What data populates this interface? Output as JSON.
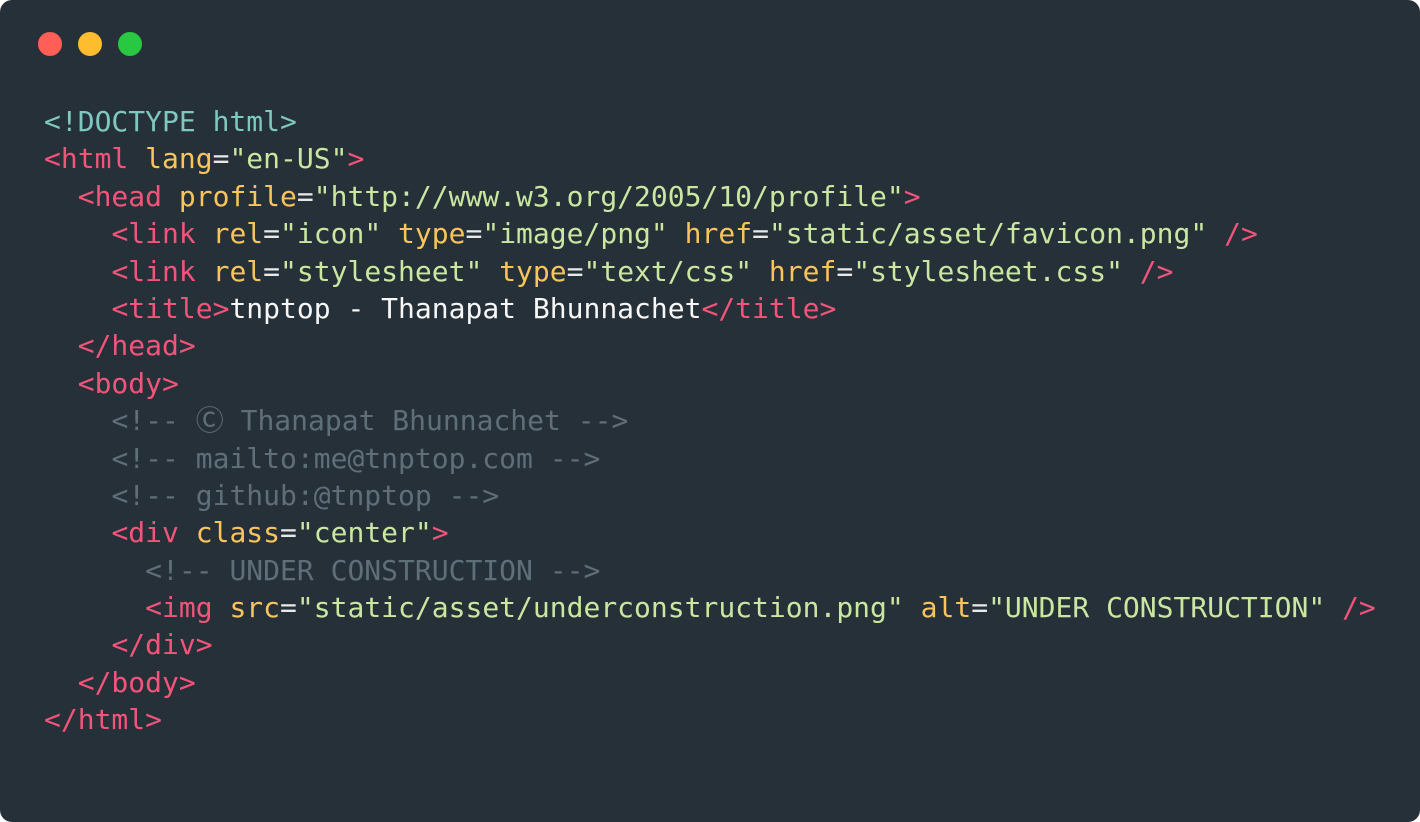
{
  "window": {
    "buttons": [
      {
        "name": "close",
        "color": "#ff5f57"
      },
      {
        "name": "minimize",
        "color": "#febc2e"
      },
      {
        "name": "zoom",
        "color": "#28c840"
      }
    ]
  },
  "theme": {
    "background": "#263038",
    "doctype": "#7ec8c0",
    "tag": "#f2547a",
    "attr": "#f8c45c",
    "string": "#c9e7a0",
    "text": "#f7f7f7",
    "comment": "#5f6f7a",
    "punct": "#e8e8e8"
  },
  "code_lines": [
    {
      "indent": 0,
      "tokens": [
        {
          "t": "doctype",
          "v": "<!DOCTYPE html>"
        }
      ]
    },
    {
      "indent": 0,
      "tokens": [
        {
          "t": "tag",
          "v": "<html"
        },
        {
          "t": "text",
          "v": " "
        },
        {
          "t": "attr",
          "v": "lang"
        },
        {
          "t": "punct",
          "v": "="
        },
        {
          "t": "string",
          "v": "\"en-US\""
        },
        {
          "t": "tag",
          "v": ">"
        }
      ]
    },
    {
      "indent": 1,
      "tokens": [
        {
          "t": "tag",
          "v": "<head"
        },
        {
          "t": "text",
          "v": " "
        },
        {
          "t": "attr",
          "v": "profile"
        },
        {
          "t": "punct",
          "v": "="
        },
        {
          "t": "string",
          "v": "\"http://www.w3.org/2005/10/profile\""
        },
        {
          "t": "tag",
          "v": ">"
        }
      ]
    },
    {
      "indent": 2,
      "tokens": [
        {
          "t": "tag",
          "v": "<link"
        },
        {
          "t": "text",
          "v": " "
        },
        {
          "t": "attr",
          "v": "rel"
        },
        {
          "t": "punct",
          "v": "="
        },
        {
          "t": "string",
          "v": "\"icon\""
        },
        {
          "t": "text",
          "v": " "
        },
        {
          "t": "attr",
          "v": "type"
        },
        {
          "t": "punct",
          "v": "="
        },
        {
          "t": "string",
          "v": "\"image/png\""
        },
        {
          "t": "text",
          "v": " "
        },
        {
          "t": "attr",
          "v": "href"
        },
        {
          "t": "punct",
          "v": "="
        },
        {
          "t": "string",
          "v": "\"static/asset/favicon.png\""
        },
        {
          "t": "text",
          "v": " "
        },
        {
          "t": "tag",
          "v": "/>"
        }
      ]
    },
    {
      "indent": 2,
      "tokens": [
        {
          "t": "tag",
          "v": "<link"
        },
        {
          "t": "text",
          "v": " "
        },
        {
          "t": "attr",
          "v": "rel"
        },
        {
          "t": "punct",
          "v": "="
        },
        {
          "t": "string",
          "v": "\"stylesheet\""
        },
        {
          "t": "text",
          "v": " "
        },
        {
          "t": "attr",
          "v": "type"
        },
        {
          "t": "punct",
          "v": "="
        },
        {
          "t": "string",
          "v": "\"text/css\""
        },
        {
          "t": "text",
          "v": " "
        },
        {
          "t": "attr",
          "v": "href"
        },
        {
          "t": "punct",
          "v": "="
        },
        {
          "t": "string",
          "v": "\"stylesheet.css\""
        },
        {
          "t": "text",
          "v": " "
        },
        {
          "t": "tag",
          "v": "/>"
        }
      ]
    },
    {
      "indent": 2,
      "tokens": [
        {
          "t": "tag",
          "v": "<title>"
        },
        {
          "t": "text",
          "v": "tnptop - Thanapat Bhunnachet"
        },
        {
          "t": "tag",
          "v": "</title>"
        }
      ]
    },
    {
      "indent": 1,
      "tokens": [
        {
          "t": "tag",
          "v": "</head>"
        }
      ]
    },
    {
      "indent": 1,
      "tokens": [
        {
          "t": "tag",
          "v": "<body>"
        }
      ]
    },
    {
      "indent": 2,
      "tokens": [
        {
          "t": "comment",
          "v": "<!-- Ⓒ Thanapat Bhunnachet -->"
        }
      ]
    },
    {
      "indent": 2,
      "tokens": [
        {
          "t": "comment",
          "v": "<!-- mailto:me@tnptop.com -->"
        }
      ]
    },
    {
      "indent": 2,
      "tokens": [
        {
          "t": "comment",
          "v": "<!-- github:@tnptop -->"
        }
      ]
    },
    {
      "indent": 2,
      "tokens": [
        {
          "t": "tag",
          "v": "<div"
        },
        {
          "t": "text",
          "v": " "
        },
        {
          "t": "attr",
          "v": "class"
        },
        {
          "t": "punct",
          "v": "="
        },
        {
          "t": "string",
          "v": "\"center\""
        },
        {
          "t": "tag",
          "v": ">"
        }
      ]
    },
    {
      "indent": 3,
      "tokens": [
        {
          "t": "comment",
          "v": "<!-- UNDER CONSTRUCTION -->"
        }
      ]
    },
    {
      "indent": 3,
      "tokens": [
        {
          "t": "tag",
          "v": "<img"
        },
        {
          "t": "text",
          "v": " "
        },
        {
          "t": "attr",
          "v": "src"
        },
        {
          "t": "punct",
          "v": "="
        },
        {
          "t": "string",
          "v": "\"static/asset/underconstruction.png\""
        },
        {
          "t": "text",
          "v": " "
        },
        {
          "t": "attr",
          "v": "alt"
        },
        {
          "t": "punct",
          "v": "="
        },
        {
          "t": "string",
          "v": "\"UNDER CONSTRUCTION\""
        },
        {
          "t": "text",
          "v": " "
        },
        {
          "t": "tag",
          "v": "/>"
        }
      ]
    },
    {
      "indent": 2,
      "tokens": [
        {
          "t": "tag",
          "v": "</div>"
        }
      ]
    },
    {
      "indent": 1,
      "tokens": [
        {
          "t": "tag",
          "v": "</body>"
        }
      ]
    },
    {
      "indent": 0,
      "tokens": [
        {
          "t": "tag",
          "v": "</html>"
        }
      ]
    }
  ]
}
